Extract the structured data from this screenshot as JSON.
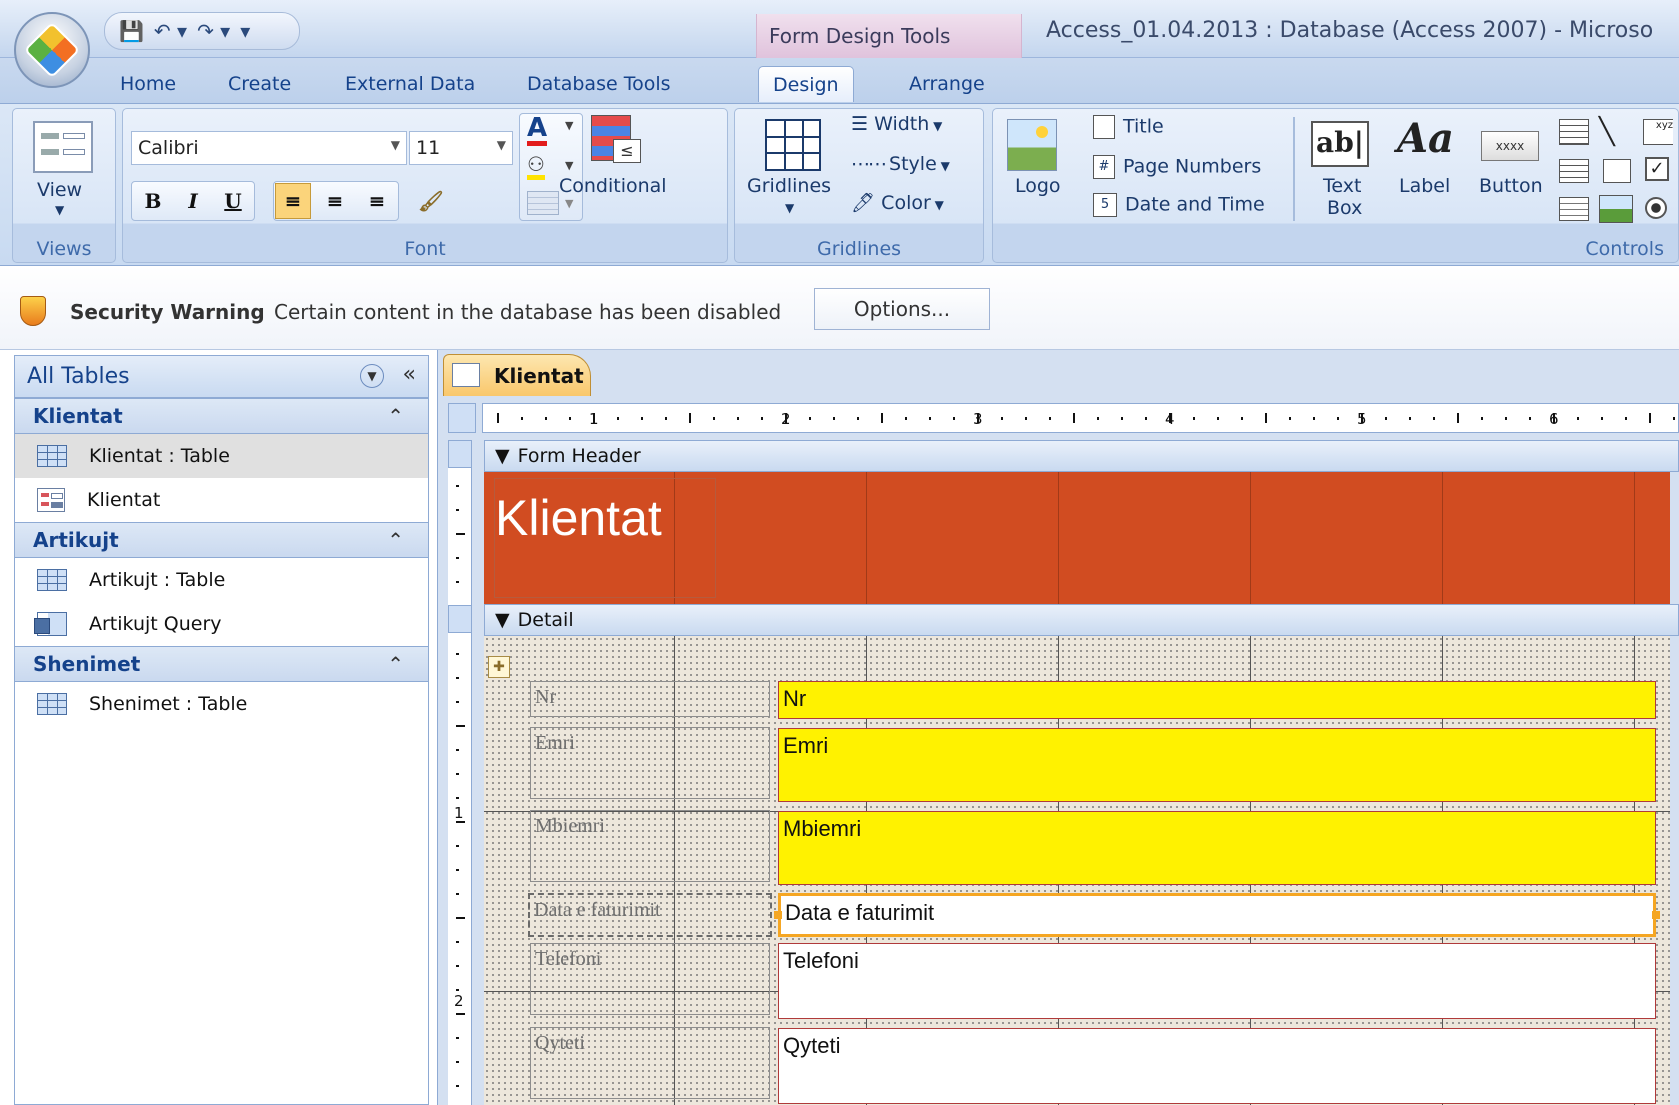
{
  "window": {
    "title": "Access_01.04.2013 : Database (Access 2007) - Microso",
    "context_tab": "Form Design Tools"
  },
  "tabs": [
    "Home",
    "Create",
    "External Data",
    "Database Tools",
    "Design",
    "Arrange"
  ],
  "active_tab": "Design",
  "ribbon": {
    "views": {
      "label": "Views",
      "view_button": "View"
    },
    "font": {
      "label": "Font",
      "font_name": "Calibri",
      "font_size": "11",
      "bold": "B",
      "italic": "I",
      "underline": "U",
      "conditional": "Conditional"
    },
    "gridlines": {
      "label": "Gridlines",
      "gridlines_button": "Gridlines",
      "width": "Width",
      "style": "Style",
      "color": "Color"
    },
    "controls": {
      "label": "Controls",
      "logo": "Logo",
      "title": "Title",
      "page_numbers": "Page Numbers",
      "date_time": "Date and Time",
      "text_box_1": "Text",
      "text_box_2": "Box",
      "text_box_glyph": "ab|",
      "label_btn": "Label",
      "label_glyph": "Aa",
      "button": "Button",
      "button_glyph": "xxxx"
    }
  },
  "security": {
    "title": "Security Warning",
    "message": "Certain content in the database has been disabled",
    "options_button": "Options..."
  },
  "nav": {
    "header": "All Tables",
    "groups": [
      {
        "name": "Klientat",
        "items": [
          "Klientat : Table",
          "Klientat"
        ]
      },
      {
        "name": "Artikujt",
        "items": [
          "Artikujt : Table",
          "Artikujt Query"
        ]
      },
      {
        "name": "Shenimet",
        "items": [
          "Shenimet : Table"
        ]
      }
    ]
  },
  "document": {
    "tab": "Klientat",
    "ruler_numbers": [
      "1",
      "2",
      "3",
      "4",
      "5",
      "6"
    ],
    "left_ruler_numbers": [
      "1",
      "2"
    ],
    "form_header_section": "Form Header",
    "header_title": "Klientat",
    "detail_section": "Detail",
    "fields": [
      {
        "label": "Nr",
        "field": "Nr"
      },
      {
        "label": "Emri",
        "field": "Emri"
      },
      {
        "label": "Mbiemri",
        "field": "Mbiemri"
      },
      {
        "label": "Data e faturimit",
        "field": "Data e faturimit"
      },
      {
        "label": "Telefoni",
        "field": "Telefoni"
      },
      {
        "label": "Qyteti",
        "field": "Qyteti"
      }
    ]
  },
  "colors": {
    "header_fill": "#d14c21",
    "field_highlight": "#fff200",
    "selection": "#f5a623"
  }
}
